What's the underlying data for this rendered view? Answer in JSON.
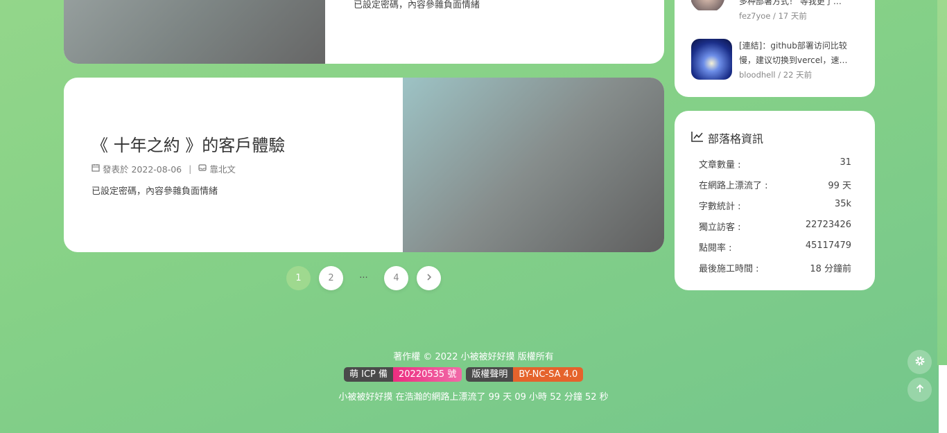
{
  "posts": [
    {
      "desc": "已設定密碼，內容參雜負面情緒"
    },
    {
      "title": "《 十年之約 》的客戶體驗",
      "date": "發表於 2022-08-06",
      "separator": "|",
      "category": "靠北文",
      "desc": "已設定密碼，內容參雜負面情緒"
    }
  ],
  "pagination": {
    "pages": [
      "1",
      "2",
      "4"
    ],
    "ellipsis": "···",
    "current": "1"
  },
  "comments": [
    {
      "text": "多种部署方式！ 等我更了…",
      "author_time": "fez7yoe / 17 天前"
    },
    {
      "text": "[連結]：github部署访问比较慢，建议切换到vercel，速…",
      "author_time": "bloodhell / 22 天前"
    }
  ],
  "blog_info": {
    "heading": "部落格資訊",
    "rows": [
      {
        "label": "文章數量 :",
        "value": "31"
      },
      {
        "label": "在網路上漂流了 :",
        "value": "99 天"
      },
      {
        "label": "字數統計 :",
        "value": "35k"
      },
      {
        "label": "獨立訪客 :",
        "value": "22723426"
      },
      {
        "label": "點閱率 :",
        "value": "45117479"
      },
      {
        "label": "最後施工時間 :",
        "value": "18 分鐘前"
      }
    ]
  },
  "footer": {
    "copyright": "著作權 © 2022 小被被好好摸 版權所有",
    "badge1_left": "萌 ICP 備",
    "badge1_right": "20220535 號",
    "badge2_left": "版權聲明",
    "badge2_right": "BY-NC-SA 4.0",
    "uptime": "小被被好好摸 在浩瀚的網路上漂流了 99 天 09 小時 52 分鐘 52 秒"
  },
  "colors": {
    "accent": "#9fd98f",
    "badge_pink": "#ec2e80",
    "badge_orange": "#e5632c"
  },
  "icons": [
    "calendar-icon",
    "inbox-icon",
    "chart-line-icon",
    "chevron-right-icon",
    "gear-icon",
    "arrow-up-icon"
  ]
}
